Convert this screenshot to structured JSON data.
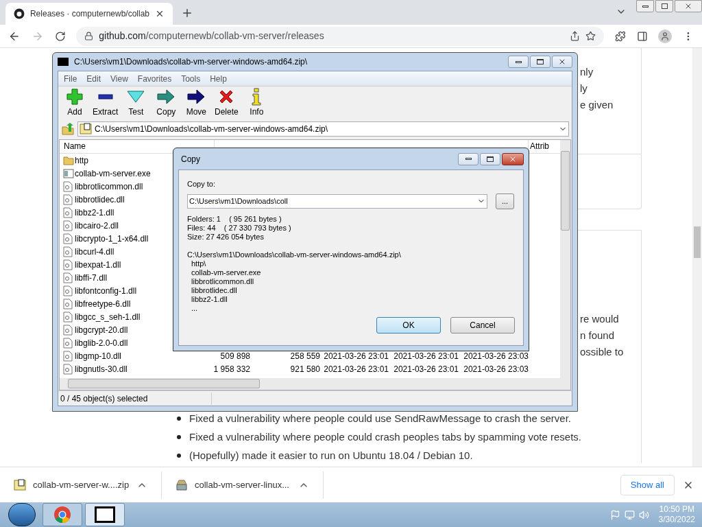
{
  "browser": {
    "tab_title": "Releases · computernewb/collab",
    "url_host": "github.com",
    "url_path": "/computernewb/collab-vm-server/releases"
  },
  "page": {
    "top_fragments": [
      "nly",
      "ly",
      "e given"
    ],
    "middle_fragments": [
      "re would",
      "n found",
      "ossible to"
    ],
    "bullets": [
      "Fixed a vulnerability where people could use SendRawMessage to crash the server.",
      "Fixed a vulnerability where people could crash peoples tabs by spamming vote resets.",
      "(Hopefully) made it easier to run on Ubuntu 18.04 / Debian 10."
    ]
  },
  "archiver": {
    "title": "C:\\Users\\vm1\\Downloads\\collab-vm-server-windows-amd64.zip\\",
    "menu": [
      "File",
      "Edit",
      "View",
      "Favorites",
      "Tools",
      "Help"
    ],
    "toolbar": [
      {
        "kind": "add",
        "label": "Add"
      },
      {
        "kind": "extract",
        "label": "Extract"
      },
      {
        "kind": "test",
        "label": "Test"
      },
      {
        "kind": "copy",
        "label": "Copy"
      },
      {
        "kind": "move",
        "label": "Move"
      },
      {
        "kind": "delete",
        "label": "Delete"
      },
      {
        "kind": "info",
        "label": "Info"
      }
    ],
    "path": "C:\\Users\\vm1\\Downloads\\collab-vm-server-windows-amd64.zip\\",
    "columns": [
      {
        "label": "Name"
      },
      {
        "label": "Attrib"
      }
    ],
    "rows": [
      {
        "kind": "folder",
        "name": "http"
      },
      {
        "kind": "exe",
        "name": "collab-vm-server.exe"
      },
      {
        "kind": "dll",
        "name": "libbrotlicommon.dll"
      },
      {
        "kind": "dll",
        "name": "libbrotlidec.dll"
      },
      {
        "kind": "dll",
        "name": "libbz2-1.dll"
      },
      {
        "kind": "dll",
        "name": "libcairo-2.dll"
      },
      {
        "kind": "dll",
        "name": "libcrypto-1_1-x64.dll"
      },
      {
        "kind": "dll",
        "name": "libcurl-4.dll"
      },
      {
        "kind": "dll",
        "name": "libexpat-1.dll"
      },
      {
        "kind": "dll",
        "name": "libffi-7.dll"
      },
      {
        "kind": "dll",
        "name": "libfontconfig-1.dll"
      },
      {
        "kind": "dll",
        "name": "libfreetype-6.dll"
      },
      {
        "kind": "dll",
        "name": "libgcc_s_seh-1.dll"
      },
      {
        "kind": "dll",
        "name": "libgcrypt-20.dll"
      },
      {
        "kind": "dll",
        "name": "libglib-2.0-0.dll"
      },
      {
        "kind": "dll",
        "name": "libgmp-10.dll",
        "size": "509 898",
        "packed": "258 559",
        "modified": "2021-03-26 23:01",
        "created": "2021-03-26 23:01",
        "accessed": "2021-03-26 23:03"
      },
      {
        "kind": "dll",
        "name": "libgnutls-30.dll",
        "size": "1 958 332",
        "packed": "921 580",
        "modified": "2021-03-26 23:01",
        "created": "2021-03-26 23:01",
        "accessed": "2021-03-26 23:03"
      }
    ],
    "status": "0 / 45 object(s) selected"
  },
  "dialog": {
    "title": "Copy",
    "copy_to_label": "Copy to:",
    "destination": "C:\\Users\\vm1\\Downloads\\coll",
    "browse": "...",
    "stats": [
      "Folders: 1    ( 95 261 bytes )",
      "Files: 44    ( 27 330 793 bytes )",
      "Size: 27 426 054 bytes"
    ],
    "source": "C:\\Users\\vm1\\Downloads\\collab-vm-server-windows-amd64.zip\\",
    "items": [
      "http\\",
      "collab-vm-server.exe",
      "libbrotlicommon.dll",
      "libbrotlidec.dll",
      "libbz2-1.dll",
      "..."
    ],
    "ok": "OK",
    "cancel": "Cancel"
  },
  "downloads": {
    "items": [
      {
        "kind": "zip",
        "name": "collab-vm-server-w....zip"
      },
      {
        "kind": "package",
        "name": "collab-vm-server-linux..."
      }
    ],
    "show_all": "Show all"
  },
  "taskbar": {
    "time": "10:50 PM",
    "date": "3/30/2022"
  }
}
